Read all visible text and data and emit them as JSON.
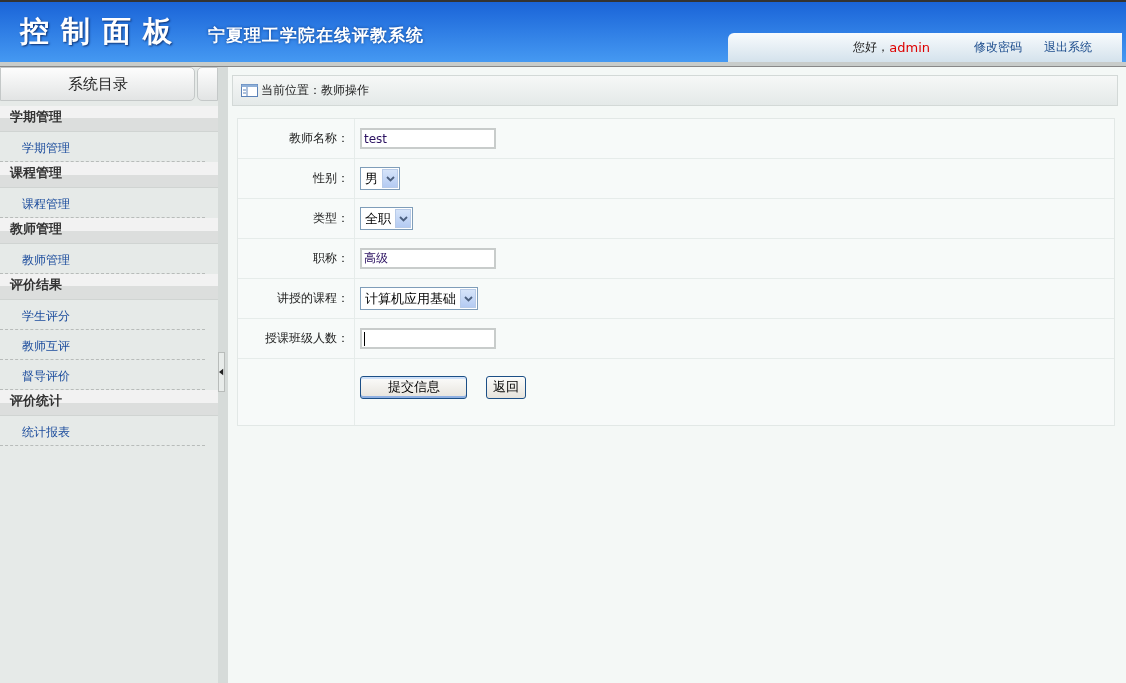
{
  "header": {
    "title": "控制面板",
    "subtitle": "宁夏理工学院在线评教系统",
    "greeting": "您好，",
    "user": "admin",
    "links": [
      "修改密码",
      "退出系统"
    ]
  },
  "sidebar": {
    "title": "系统目录",
    "groups": [
      {
        "title": "学期管理",
        "items": [
          {
            "label": "学期管理"
          }
        ]
      },
      {
        "title": "课程管理",
        "items": [
          {
            "label": "课程管理"
          }
        ]
      },
      {
        "title": "教师管理",
        "items": [
          {
            "label": "教师管理"
          }
        ]
      },
      {
        "title": "评价结果",
        "items": [
          {
            "label": "学生评分"
          },
          {
            "label": "教师互评"
          },
          {
            "label": "督导评价"
          }
        ]
      },
      {
        "title": "评价统计",
        "items": [
          {
            "label": "统计报表"
          }
        ]
      }
    ]
  },
  "breadcrumb": "当前位置：教师操作",
  "form": {
    "rows": [
      {
        "kind": "input",
        "label": "教师名称：",
        "value": "test",
        "focused": false
      },
      {
        "kind": "select",
        "label": "性别：",
        "value": "男"
      },
      {
        "kind": "select",
        "label": "类型：",
        "value": "全职"
      },
      {
        "kind": "input",
        "label": "职称：",
        "value": "高级",
        "focused": false
      },
      {
        "kind": "select",
        "label": "讲授的课程：",
        "value": "计算机应用基础"
      },
      {
        "kind": "input",
        "label": "授课班级人数：",
        "value": "",
        "focused": true
      }
    ],
    "buttons": [
      {
        "label": "提交信息",
        "kind": "primary"
      },
      {
        "label": "返回",
        "kind": "plain"
      }
    ]
  }
}
